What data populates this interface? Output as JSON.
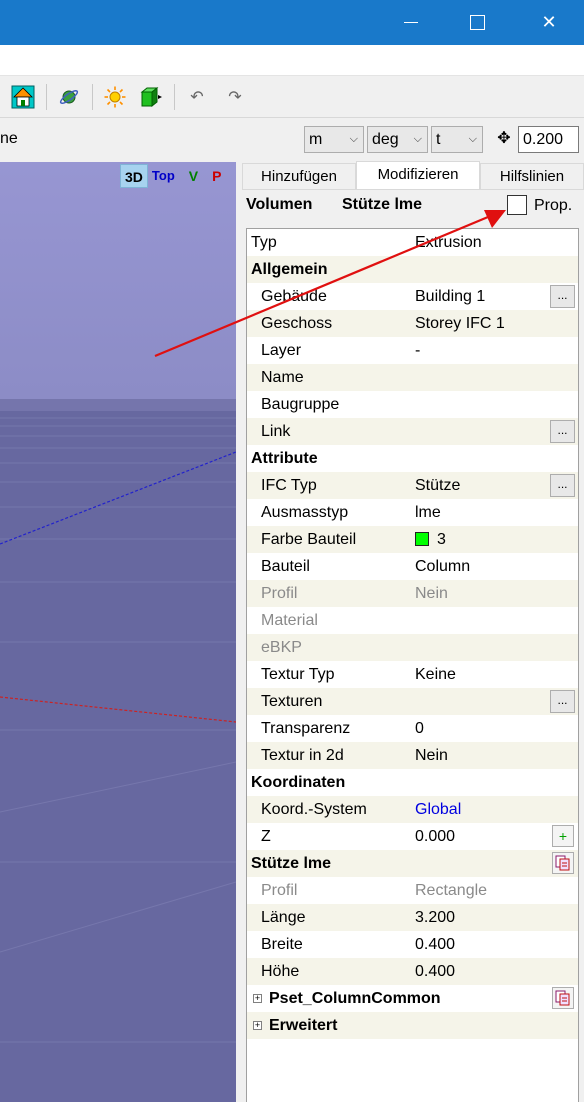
{
  "window": {
    "minimize_icon": "minimize-icon",
    "maximize_icon": "maximize-icon",
    "close_icon": "close-icon",
    "close_glyph": "✕"
  },
  "toolbar2": {
    "left_label": "ne",
    "unit_length": "m",
    "unit_angle": "deg",
    "unit_mass": "t",
    "snap_value": "0.200"
  },
  "view": {
    "btn_3d": "3D",
    "btn_top": "Top",
    "btn_v": "V",
    "btn_p": "P"
  },
  "tabs": [
    "Hinzufügen",
    "Modifizieren",
    "Hilfslinien"
  ],
  "header": {
    "type": "Volumen",
    "name": "Stütze lme",
    "prop_label": "Prop."
  },
  "props": {
    "typ": {
      "k": "Typ",
      "v": "Extrusion"
    },
    "allgemein": "Allgemein",
    "gebaeude": {
      "k": "Gebäude",
      "v": "Building 1"
    },
    "geschoss": {
      "k": "Geschoss",
      "v": "Storey IFC 1"
    },
    "layer": {
      "k": "Layer",
      "v": "-"
    },
    "name": {
      "k": "Name",
      "v": ""
    },
    "baugruppe": {
      "k": "Baugruppe",
      "v": ""
    },
    "link": {
      "k": "Link",
      "v": ""
    },
    "attribute": "Attribute",
    "ifctyp": {
      "k": "IFC Typ",
      "v": "Stütze"
    },
    "ausmasstyp": {
      "k": "Ausmasstyp",
      "v": "lme"
    },
    "farbe": {
      "k": "Farbe Bauteil",
      "v": "3"
    },
    "bauteil": {
      "k": "Bauteil",
      "v": "Column"
    },
    "profil1": {
      "k": "Profil",
      "v": "Nein"
    },
    "material": {
      "k": "Material",
      "v": ""
    },
    "ebkp": {
      "k": "eBKP",
      "v": ""
    },
    "texturtyp": {
      "k": "Textur Typ",
      "v": "Keine"
    },
    "texturen": {
      "k": "Texturen",
      "v": ""
    },
    "transparenz": {
      "k": "Transparenz",
      "v": "0"
    },
    "textur2d": {
      "k": "Textur in 2d",
      "v": "Nein"
    },
    "koordinaten": "Koordinaten",
    "koordsys": {
      "k": "Koord.-System",
      "v": "Global"
    },
    "z": {
      "k": "Z",
      "v": "0.000"
    },
    "stuetze": "Stütze lme",
    "profil2": {
      "k": "Profil",
      "v": "Rectangle"
    },
    "laenge": {
      "k": "Länge",
      "v": "3.200"
    },
    "breite": {
      "k": "Breite",
      "v": "0.400"
    },
    "hoehe": {
      "k": "Höhe",
      "v": "0.400"
    },
    "pset": "Pset_ColumnCommon",
    "erweitert": "Erweitert",
    "ellipsis": "...",
    "plus": "+",
    "expand": "+"
  },
  "colors": {
    "titlebar": "#1979ca",
    "viewport": "#6768a0",
    "sky": "#9292cc",
    "annotation_arrow": "#e01010",
    "color_swatch": "#00ff00"
  }
}
